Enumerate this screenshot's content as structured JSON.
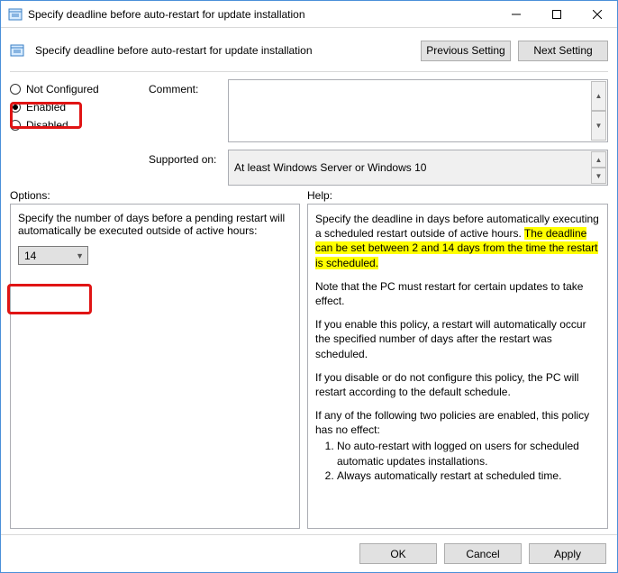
{
  "window": {
    "title": "Specify deadline before auto-restart for update installation"
  },
  "header": {
    "subtitle": "Specify deadline before auto-restart for update installation",
    "prev_btn": "Previous Setting",
    "next_btn": "Next Setting"
  },
  "state": {
    "not_configured": "Not Configured",
    "enabled": "Enabled",
    "disabled": "Disabled"
  },
  "labels": {
    "comment": "Comment:",
    "supported_on": "Supported on:",
    "options": "Options:",
    "help": "Help:"
  },
  "fields": {
    "comment_value": "",
    "supported_value": "At least Windows Server or Windows 10"
  },
  "options": {
    "description": "Specify the number of days before a pending restart will automatically be executed outside of active hours:",
    "selected": "14"
  },
  "help": {
    "p1a": "Specify the deadline in days before automatically executing a scheduled restart outside of active hours. ",
    "p1b": "The deadline can be set between 2 and 14 days from the time the restart is scheduled.",
    "p2": "Note that the PC must restart for certain updates to take effect.",
    "p3": "If you enable this policy, a restart will automatically occur the specified number of days after the restart was scheduled.",
    "p4": "If you disable or do not configure this policy, the PC will restart according to the default schedule.",
    "p5": "If any of the following two policies are enabled, this policy has no effect:",
    "li1": "No auto-restart with logged on users for scheduled automatic updates installations.",
    "li2": "Always automatically restart at scheduled time."
  },
  "footer": {
    "ok": "OK",
    "cancel": "Cancel",
    "apply": "Apply"
  }
}
